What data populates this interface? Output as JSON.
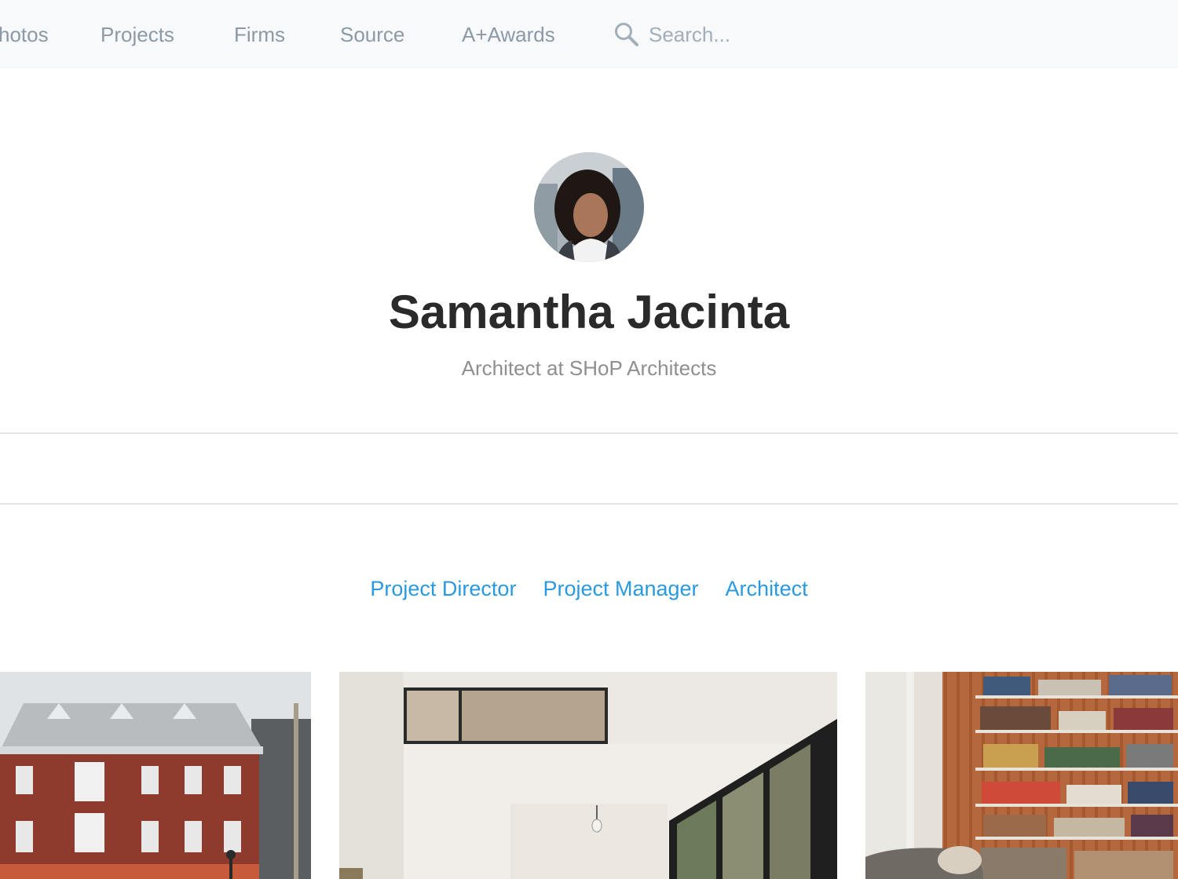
{
  "nav": {
    "items": [
      "hotos",
      "Projects",
      "Firms",
      "Source",
      "A+Awards"
    ],
    "search_placeholder": "Search..."
  },
  "profile": {
    "name": "Samantha Jacinta",
    "subtitle": "Architect at SHoP Architects"
  },
  "roles": [
    "Project Director",
    "Project Manager",
    "Architect"
  ],
  "colors": {
    "nav_text": "#8c99a6",
    "role_link": "#2a9ae0",
    "name_text": "#2a2a2a",
    "topbar_bg": "#f7f9fa"
  }
}
